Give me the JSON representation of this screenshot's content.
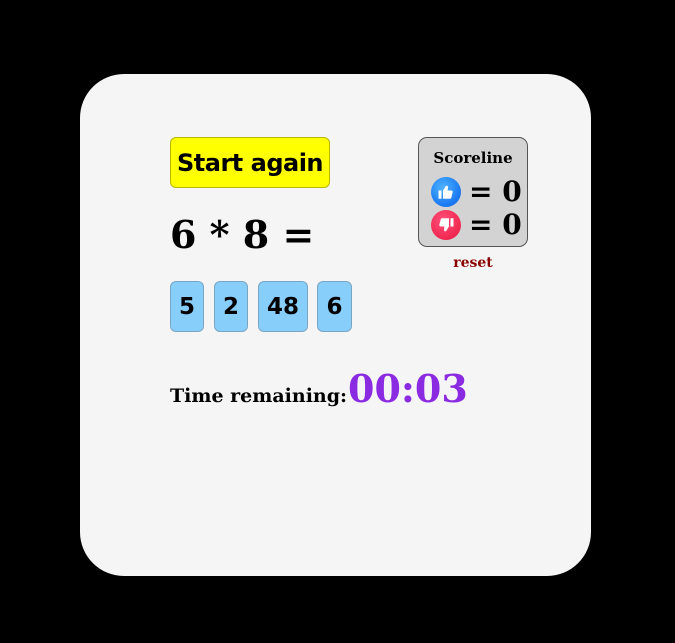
{
  "game": {
    "start_button_label": "Start again",
    "question": "6 * 8 =",
    "answers": [
      "5",
      "2",
      "48",
      "6"
    ],
    "timer_label": "Time remaining:",
    "timer_value": "00:03"
  },
  "scoreline": {
    "title": "Scoreline",
    "correct_text": "= 0",
    "wrong_text": "= 0",
    "correct_icon": "thumbs-up-icon",
    "wrong_icon": "thumbs-down-icon",
    "reset_label": "reset"
  },
  "colors": {
    "page_background": "#000000",
    "card_background": "#f5f5f5",
    "start_button": "#ffff00",
    "answer_button": "#87cefa",
    "timer": "#8a2be2",
    "reset": "#8b0000",
    "thumbs_up": "#1877f2",
    "thumbs_down": "#f02850"
  }
}
